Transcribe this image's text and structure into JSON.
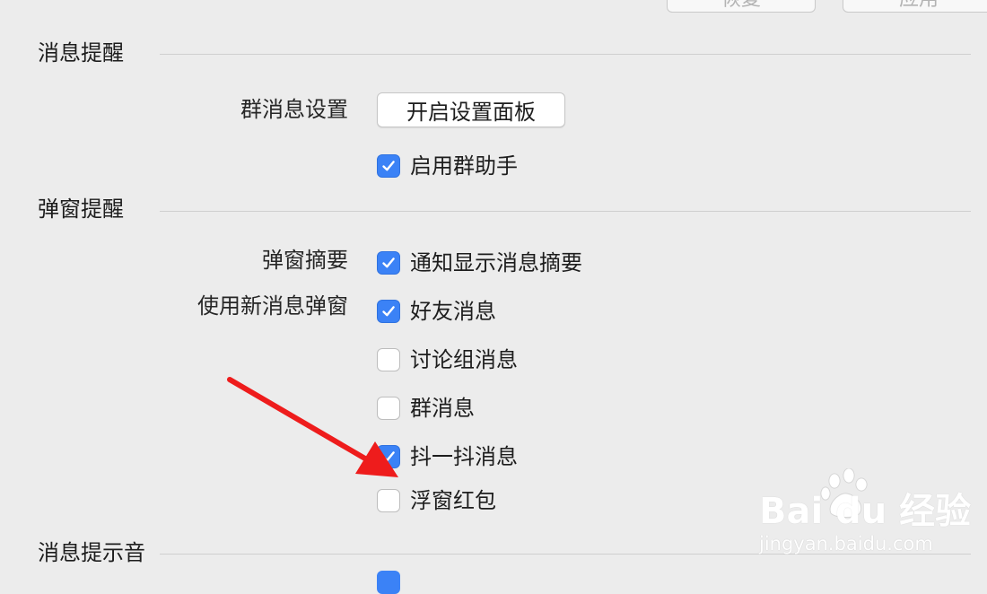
{
  "toolbar": {
    "restore_label": "恢复",
    "apply_label": "应用"
  },
  "sections": {
    "message_reminder": {
      "title": "消息提醒",
      "group_settings_label": "群消息设置",
      "open_panel_button": "开启设置面板",
      "enable_group_assistant": {
        "label": "启用群助手",
        "checked": true
      }
    },
    "popup_reminder": {
      "title": "弹窗提醒",
      "popup_summary_label": "弹窗摘要",
      "show_summary": {
        "label": "通知显示消息摘要",
        "checked": true
      },
      "new_popup_label": "使用新消息弹窗",
      "options": [
        {
          "label": "好友消息",
          "checked": true
        },
        {
          "label": "讨论组消息",
          "checked": false
        },
        {
          "label": "群消息",
          "checked": false
        },
        {
          "label": "抖一抖消息",
          "checked": true
        },
        {
          "label": "浮窗红包",
          "checked": false
        }
      ]
    },
    "sound": {
      "title": "消息提示音"
    }
  },
  "watermark": {
    "brand": "Bai du 经验",
    "url": "jingyan.baidu.com"
  },
  "colors": {
    "background": "#ececec",
    "checkbox_checked": "#3b82f6",
    "annotation_arrow": "#ee1c1c"
  },
  "icons": {
    "check": "check-icon",
    "annotation": "red-arrow-icon",
    "watermark_logo": "baidu-paw-icon"
  }
}
